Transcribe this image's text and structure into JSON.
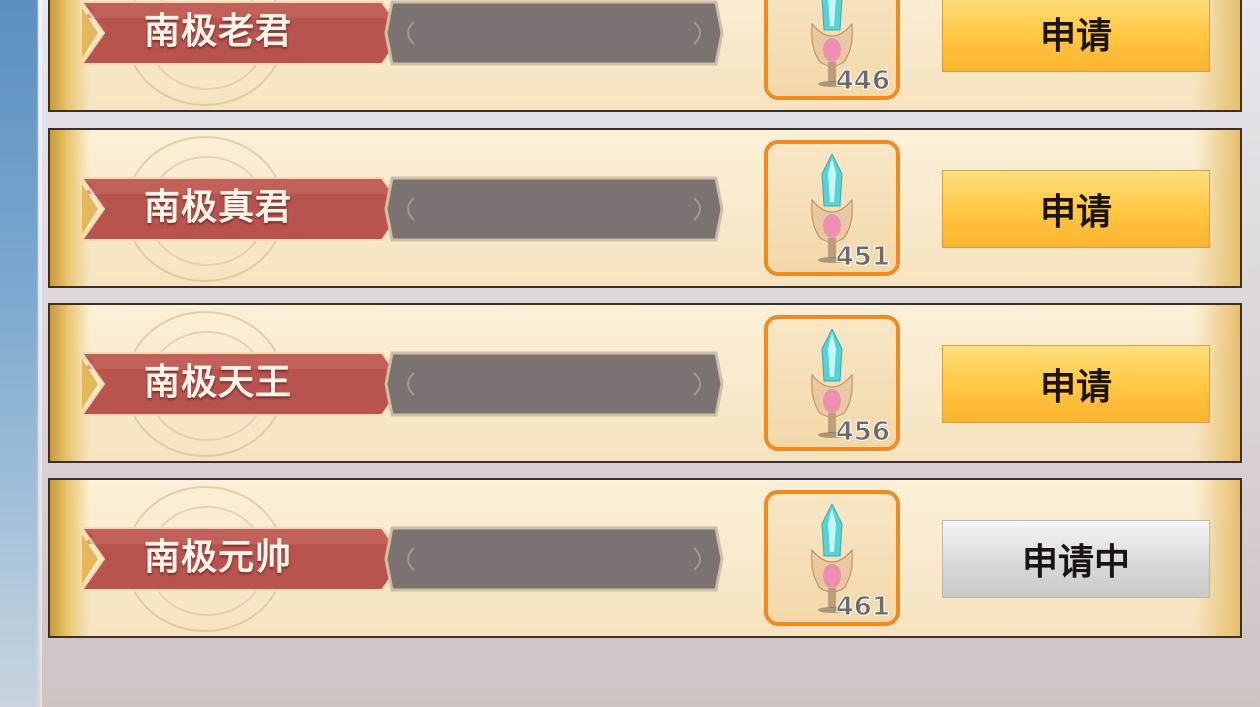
{
  "rows": [
    {
      "name": "南极老君",
      "count": "446",
      "button": "申请",
      "state": "apply"
    },
    {
      "name": "南极真君",
      "count": "451",
      "button": "申请",
      "state": "apply"
    },
    {
      "name": "南极天王",
      "count": "456",
      "button": "申请",
      "state": "apply"
    },
    {
      "name": "南极元帅",
      "count": "461",
      "button": "申请中",
      "state": "pending"
    }
  ],
  "item_icon": "crystal-sword-icon",
  "colors": {
    "ribbon": "#b8534e",
    "item_border": "#f18b1f",
    "apply_button": "#ffc845",
    "pending_button": "#dcdcdc"
  }
}
